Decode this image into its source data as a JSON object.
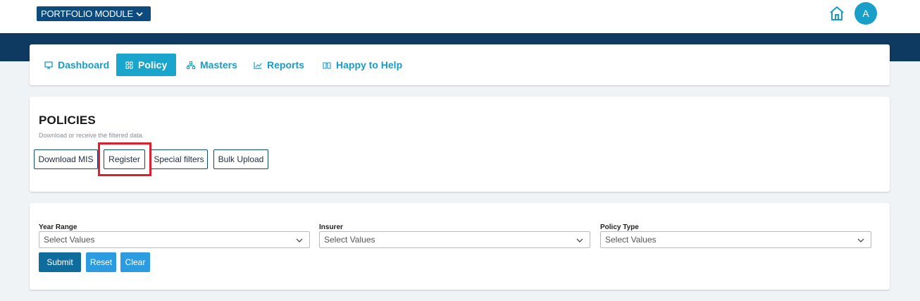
{
  "header": {
    "module_selector": "PORTFOLIO MODULE",
    "avatar_initial": "A"
  },
  "nav": {
    "tabs": [
      {
        "label": "Dashboard",
        "icon": "monitor-icon",
        "active": false
      },
      {
        "label": "Policy",
        "icon": "grid-icon",
        "active": true
      },
      {
        "label": "Masters",
        "icon": "hierarchy-icon",
        "active": false
      },
      {
        "label": "Reports",
        "icon": "line-chart-icon",
        "active": false
      },
      {
        "label": "Happy to Help",
        "icon": "book-icon",
        "active": false
      }
    ]
  },
  "policies": {
    "title": "POLICIES",
    "subtitle": "Download or receive the filtered data.",
    "buttons": [
      "Download MIS",
      "Register",
      "Special filters",
      "Bulk Upload"
    ],
    "highlighted_button": "Register"
  },
  "filters": {
    "fields": [
      {
        "label": "Year Range",
        "placeholder": "Select Values"
      },
      {
        "label": "Insurer",
        "placeholder": "Select Values"
      },
      {
        "label": "Policy Type",
        "placeholder": "Select Values"
      }
    ],
    "actions": [
      "Submit",
      "Reset",
      "Clear"
    ]
  },
  "colors": {
    "navy": "#0e3a62",
    "brand_blue": "#0d4a7e",
    "accent_teal": "#1aa5cc",
    "highlight_red": "#e01e2d",
    "submit": "#0f6d9e",
    "reset_clear": "#2d9be0"
  }
}
